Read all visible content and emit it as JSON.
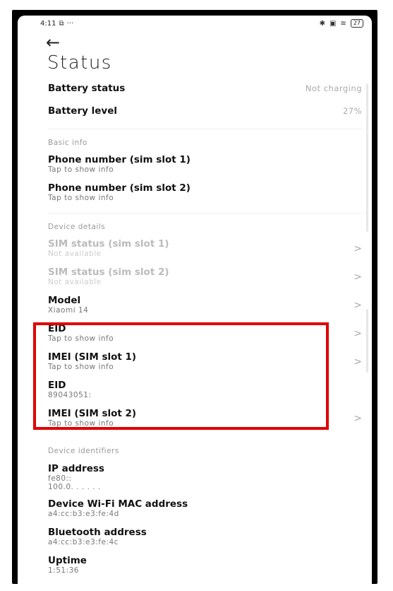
{
  "status_bar": {
    "time": "4:11",
    "left_icons": [
      "cast-icon",
      "more-dots-icon"
    ],
    "right_icons": [
      "bluetooth-icon",
      "nfc-icon",
      "wifi-icon",
      "battery-icon"
    ],
    "battery": "27"
  },
  "page": {
    "title": "Status",
    "back_icon": "←"
  },
  "battery": {
    "status_label": "Battery status",
    "status_value": "Not charging",
    "level_label": "Battery level",
    "level_value": "27%"
  },
  "basic_info": {
    "header": "Basic info",
    "items": [
      {
        "title": "Phone number (sim slot 1)",
        "sub": "Tap to show info"
      },
      {
        "title": "Phone number (sim slot 2)",
        "sub": "Tap to show info"
      }
    ]
  },
  "device_details": {
    "header": "Device details",
    "items": [
      {
        "title": "SIM status (sim slot 1)",
        "sub": "Not available"
      },
      {
        "title": "SIM status (sim slot 2)",
        "sub": "Not available"
      },
      {
        "title": "Model",
        "sub": "Xiaomi 14"
      },
      {
        "title": "EID",
        "sub": "Tap to show info"
      },
      {
        "title": "IMEI (SIM slot 1)",
        "sub": "Tap to show info"
      },
      {
        "title": "EID",
        "sub": "89043051:"
      },
      {
        "title": "IMEI (SIM slot 2)",
        "sub": "Tap to show info"
      }
    ]
  },
  "device_identifiers": {
    "header": "Device identifiers",
    "items": [
      {
        "title": "IP address",
        "sub": "fe80::",
        "sub2": "100.0. . . . . ."
      },
      {
        "title": "Device Wi-Fi MAC address",
        "sub": "a4:cc:b3:e3:fe:4d"
      },
      {
        "title": "Bluetooth address",
        "sub": "a4:cc:b3:e3:fe:4c"
      },
      {
        "title": "Uptime",
        "sub": "1:51:36"
      }
    ]
  },
  "chevron": ">",
  "colors": {
    "highlight": "#e00000",
    "frame": "#000000"
  }
}
